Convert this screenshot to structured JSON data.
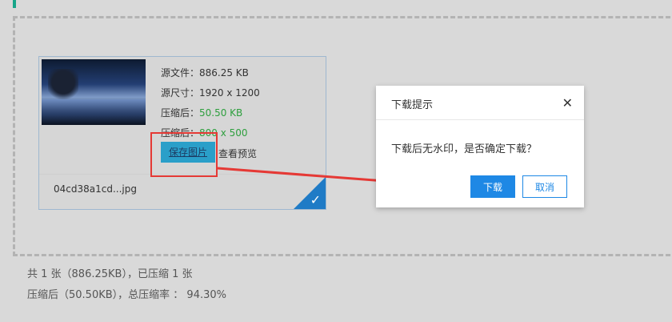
{
  "card": {
    "source_file": "源文件：886.25 KB",
    "source_size": "源尺寸：1920 x 1200",
    "compressed_label": "压缩后：",
    "compressed_size": "50.50 KB",
    "compressed_dim_label": "压缩后：",
    "compressed_dim": "800 x 500",
    "save_button": "保存图片",
    "preview_link": "查看预览",
    "filename": "04cd38a1cd...jpg"
  },
  "modal": {
    "title": "下载提示",
    "message": "下载后无水印，是否确定下载？",
    "download_button": "下载",
    "cancel_button": "取消"
  },
  "summary": {
    "line1": "共 1 张（886.25KB），已压缩 1 张",
    "line2": "压缩后（50.50KB），总压缩率 ： 94.30%"
  },
  "colors": {
    "accent": "#17a589",
    "green_text": "#2e9f3e",
    "primary_blue": "#1e88e5",
    "highlight_red": "#e53935"
  },
  "icons": {
    "close": "close-icon",
    "check": "checkmark-icon"
  }
}
